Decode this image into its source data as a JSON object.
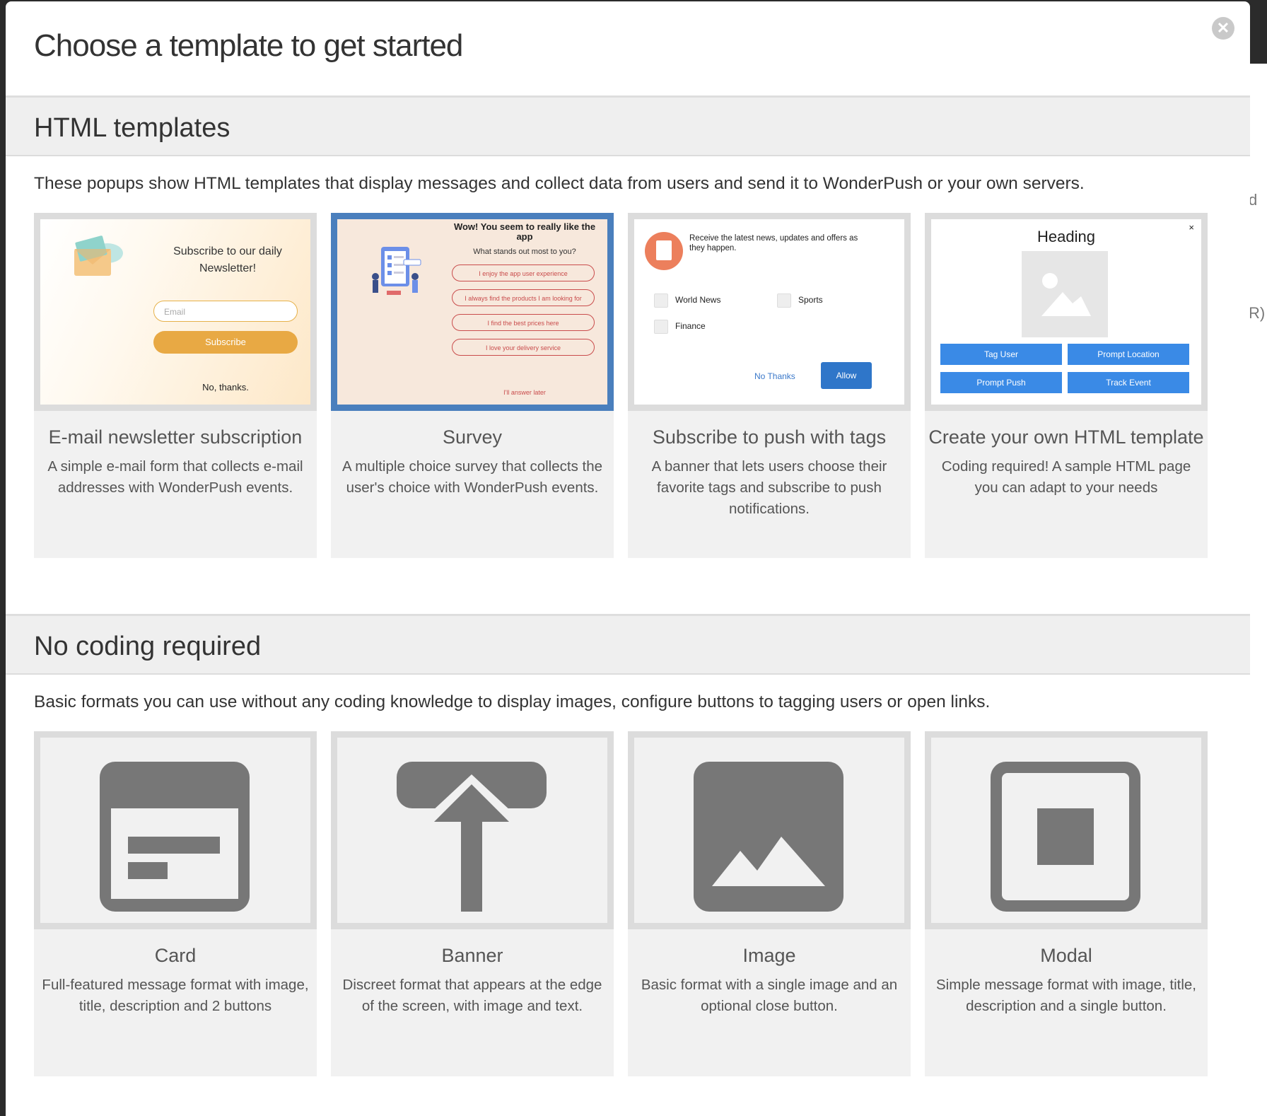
{
  "modal": {
    "title": "Choose a template to get started",
    "close_label": "✕"
  },
  "backdrop": {
    "fragment_1": "d",
    "fragment_2": "R)"
  },
  "html_section": {
    "heading": "HTML templates",
    "description": "These popups show HTML templates that display messages and collect data from users and send it to WonderPush or your own servers.",
    "cards": [
      {
        "title": "E-mail newsletter subscription",
        "description": "A simple e-mail form that collects e-mail addresses with WonderPush events.",
        "preview": {
          "heading": "Subscribe to our daily Newsletter!",
          "email_placeholder": "Email",
          "button": "Subscribe",
          "decline": "No, thanks."
        }
      },
      {
        "title": "Survey",
        "description": "A multiple choice survey that collects the user's choice with WonderPush events.",
        "selected": true,
        "preview": {
          "heading": "Wow! You seem to really like the app",
          "question": "What stands out most to you?",
          "options": [
            "I enjoy the app user experience",
            "I always find the products I am looking for",
            "I find the best prices here",
            "I love your delivery service"
          ],
          "later": "I'll answer later"
        }
      },
      {
        "title": "Subscribe to push with tags",
        "description": "A banner that lets users choose their favorite tags and subscribe to push notifications.",
        "preview": {
          "message": "Receive the latest news, updates and offers as they happen.",
          "tags": [
            "World News",
            "Sports",
            "Finance"
          ],
          "decline": "No Thanks",
          "accept": "Allow"
        }
      },
      {
        "title": "Create your own HTML template",
        "description": "Coding required! A sample HTML page you can adapt to your needs",
        "preview": {
          "close": "×",
          "heading": "Heading",
          "buttons": [
            "Tag User",
            "Prompt Location",
            "Prompt Push",
            "Track Event"
          ]
        }
      }
    ]
  },
  "nocode_section": {
    "heading": "No coding required",
    "description": "Basic formats you can use without any coding knowledge to display images, configure buttons to tagging users or open links.",
    "cards": [
      {
        "title": "Card",
        "description": "Full-featured message format with image, title, description and 2 buttons",
        "icon": "card-format-icon"
      },
      {
        "title": "Banner",
        "description": "Discreet format that appears at the edge of the screen, with image and text.",
        "icon": "banner-format-icon"
      },
      {
        "title": "Image",
        "description": "Basic format with a single image and an optional close button.",
        "icon": "image-format-icon"
      },
      {
        "title": "Modal",
        "description": "Simple message format with image, title, description and a single button.",
        "icon": "modal-format-icon"
      }
    ]
  },
  "colors": {
    "selected_border": "#4a7fbd",
    "icon_gray": "#777777",
    "section_bg": "#efefef",
    "button_blue": "#3a8ae6",
    "subscribe_orange": "#e8a944"
  }
}
